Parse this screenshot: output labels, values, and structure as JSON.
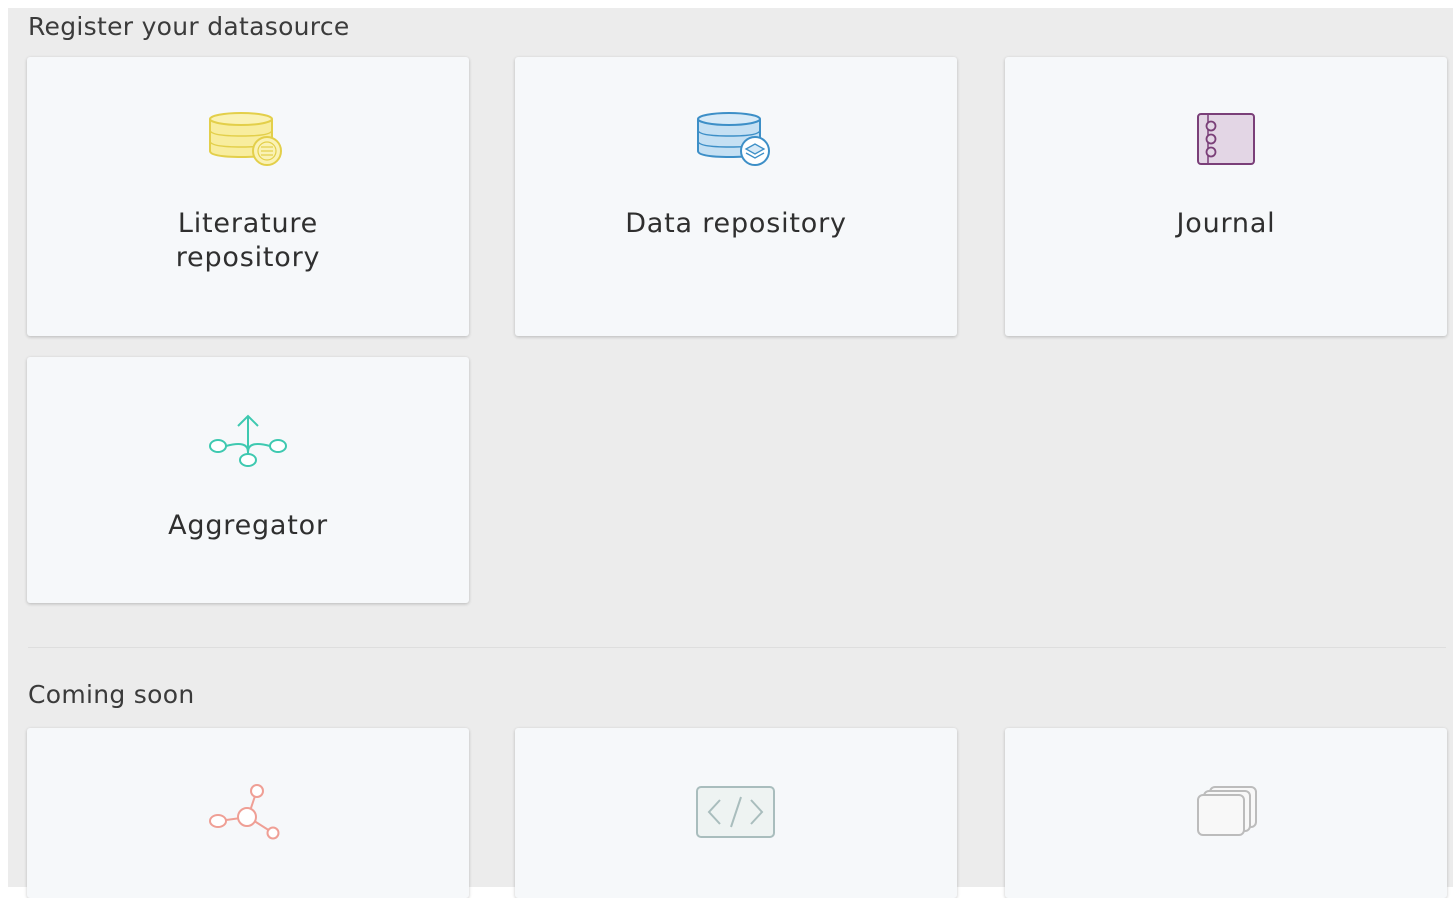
{
  "register_section": {
    "title": "Register your datasource",
    "cards": [
      {
        "label": "Literature repository",
        "icon": "literature-repository-icon",
        "color": "#e8d44d"
      },
      {
        "label": "Data repository",
        "icon": "data-repository-icon",
        "color": "#3d8fc7"
      },
      {
        "label": "Journal",
        "icon": "journal-icon",
        "color": "#7a3f78"
      },
      {
        "label": "Aggregator",
        "icon": "aggregator-icon",
        "color": "#3ec9b0"
      }
    ]
  },
  "coming_soon_section": {
    "title": "Coming soon",
    "cards": [
      {
        "icon": "network-icon",
        "color": "#ef9f95"
      },
      {
        "icon": "code-icon",
        "color": "#9fb4b4"
      },
      {
        "icon": "stacked-pages-icon",
        "color": "#b4b4b4"
      }
    ]
  }
}
